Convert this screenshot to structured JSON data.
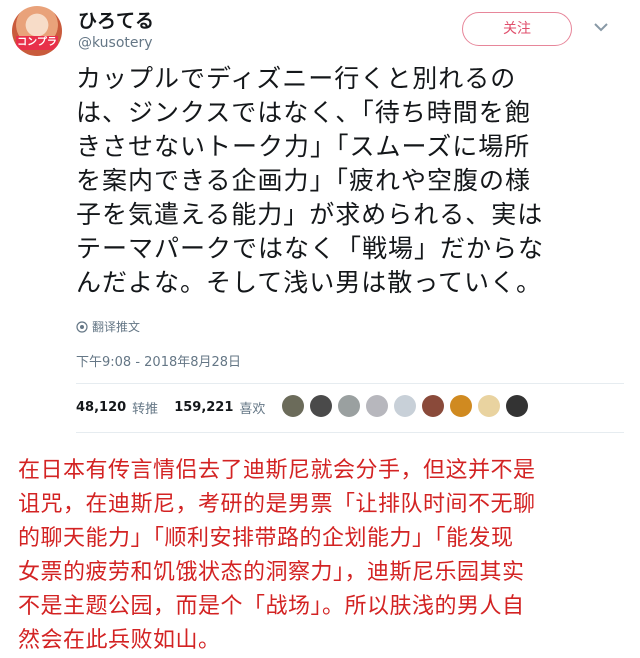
{
  "author": {
    "display_name": "ひろてる",
    "handle": "@kusotery",
    "avatar_badge": "コンプラ"
  },
  "follow_label": "关注",
  "tweet": {
    "lines": [
      "カップルでディズニー行くと別れるの",
      "は、ジンクスではなく、「待ち時間を飽",
      "きさせないトーク力」「スムーズに場所",
      "を案内できる企画力」「疲れや空腹の様",
      "子を気遣える能力」が求められる、実は",
      "テーマパークではなく「戦場」だからな",
      "んだよな。そして浅い男は散っていく。"
    ],
    "translate_label": "翻译推文",
    "timestamp": "下午9:08 - 2018年8月28日"
  },
  "stats": {
    "retweets_count": "48,120",
    "retweets_label": "转推",
    "likes_count": "159,221",
    "likes_label": "喜欢"
  },
  "likers": [
    {
      "icon": "bird-avatar-icon",
      "color": "#6b6b5a"
    },
    {
      "icon": "dark-avatar-icon",
      "color": "#4a4a4a"
    },
    {
      "icon": "grey-avatar-icon",
      "color": "#9aa0a0"
    },
    {
      "icon": "anime-avatar-icon",
      "color": "#b7b7bd"
    },
    {
      "icon": "blank-avatar-icon",
      "color": "#c8d0d8"
    },
    {
      "icon": "redhair-avatar-icon",
      "color": "#8a4a3a"
    },
    {
      "icon": "orange-avatar-icon",
      "color": "#d08a20"
    },
    {
      "icon": "blond-avatar-icon",
      "color": "#e9d3a0"
    },
    {
      "icon": "yinyang-avatar-icon",
      "color": "#333333"
    }
  ],
  "caption": {
    "lines": [
      "在日本有传言情侣去了迪斯尼就会分手，但这并不是",
      "诅咒，在迪斯尼，考研的是男票「让排队时间不无聊",
      "的聊天能力」「顺利安排带路的企划能力」「能发现",
      "女票的疲劳和饥饿状态的洞察力」，迪斯尼乐园其实",
      "不是主题公园，而是个「战场」。所以肤浅的男人自",
      "然会在此兵败如山。"
    ]
  }
}
